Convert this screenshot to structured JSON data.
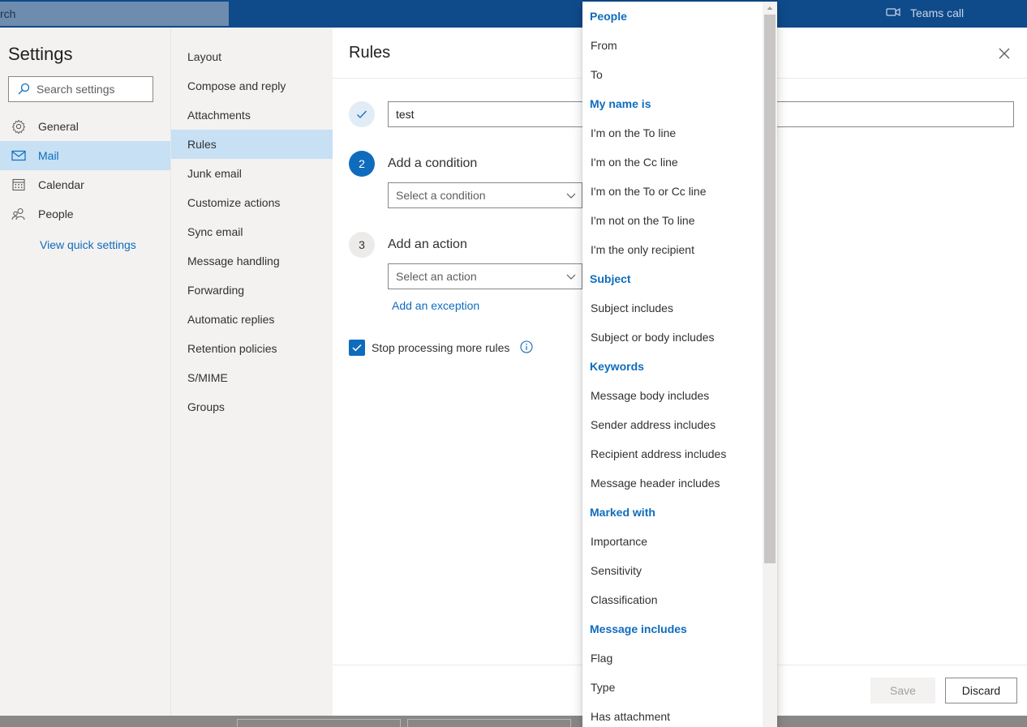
{
  "app": {
    "search_partial": "rch",
    "teams_call": "Teams call"
  },
  "settings": {
    "title": "Settings",
    "search_placeholder": "Search settings",
    "categories": [
      {
        "label": "General",
        "icon": "gear-icon"
      },
      {
        "label": "Mail",
        "icon": "mail-icon"
      },
      {
        "label": "Calendar",
        "icon": "calendar-icon"
      },
      {
        "label": "People",
        "icon": "people-icon"
      }
    ],
    "quick_settings": "View quick settings"
  },
  "mail_nav": {
    "items": [
      "Layout",
      "Compose and reply",
      "Attachments",
      "Rules",
      "Junk email",
      "Customize actions",
      "Sync email",
      "Message handling",
      "Forwarding",
      "Automatic replies",
      "Retention policies",
      "S/MIME",
      "Groups"
    ],
    "active": "Rules"
  },
  "rules": {
    "title": "Rules",
    "rule_name": "test",
    "step2_num": "2",
    "step2_label": "Add a condition",
    "condition_placeholder": "Select a condition",
    "step3_num": "3",
    "step3_label": "Add an action",
    "action_placeholder": "Select an action",
    "add_exception": "Add an exception",
    "stop_processing": "Stop processing more rules",
    "stop_processing_checked": true,
    "save": "Save",
    "discard": "Discard"
  },
  "condition_menu": {
    "rows": [
      {
        "text": "People",
        "header": true
      },
      {
        "text": "From",
        "header": false
      },
      {
        "text": "To",
        "header": false
      },
      {
        "text": "My name is",
        "header": true
      },
      {
        "text": "I'm on the To line",
        "header": false
      },
      {
        "text": "I'm on the Cc line",
        "header": false
      },
      {
        "text": "I'm on the To or Cc line",
        "header": false
      },
      {
        "text": "I'm not on the To line",
        "header": false
      },
      {
        "text": "I'm the only recipient",
        "header": false
      },
      {
        "text": "Subject",
        "header": true
      },
      {
        "text": "Subject includes",
        "header": false
      },
      {
        "text": "Subject or body includes",
        "header": false
      },
      {
        "text": "Keywords",
        "header": true
      },
      {
        "text": "Message body includes",
        "header": false
      },
      {
        "text": "Sender address includes",
        "header": false
      },
      {
        "text": "Recipient address includes",
        "header": false
      },
      {
        "text": "Message header includes",
        "header": false
      },
      {
        "text": "Marked with",
        "header": true
      },
      {
        "text": "Importance",
        "header": false
      },
      {
        "text": "Sensitivity",
        "header": false
      },
      {
        "text": "Classification",
        "header": false
      },
      {
        "text": "Message includes",
        "header": true
      },
      {
        "text": "Flag",
        "header": false
      },
      {
        "text": "Type",
        "header": false
      },
      {
        "text": "Has attachment",
        "header": false
      }
    ]
  },
  "colors": {
    "accent": "#0f6cbd",
    "topbar": "#0f4a8a",
    "selected": "#c7e0f4"
  }
}
